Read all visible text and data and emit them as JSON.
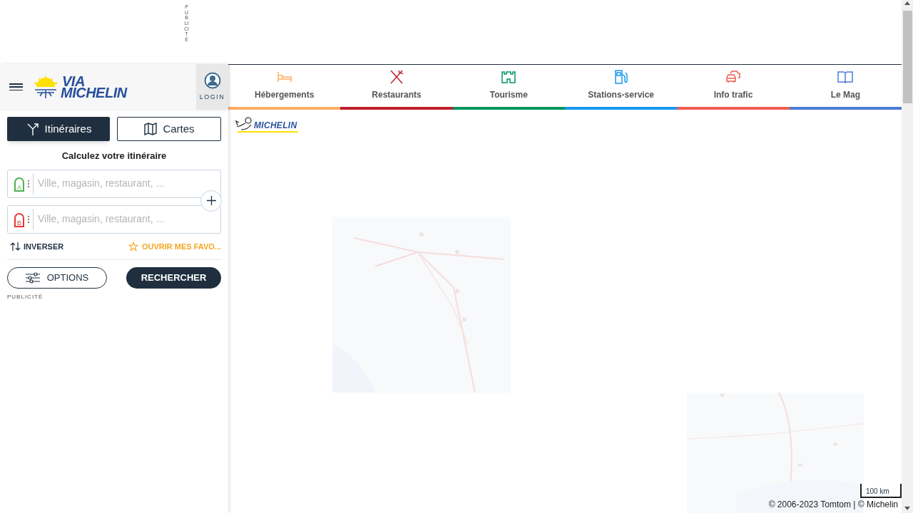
{
  "ad_banner": {
    "label": "PUBLICITÉ"
  },
  "header": {
    "logo_top": "VIA",
    "logo_bottom": "MICHELIN",
    "login": "LOGIN"
  },
  "mode_tabs": [
    {
      "label": "Itinéraires",
      "selected": true,
      "kind": "route"
    },
    {
      "label": "Cartes",
      "selected": false,
      "kind": "map"
    }
  ],
  "route_form": {
    "title": "Calculez votre itinéraire",
    "stops": [
      {
        "letter": "A",
        "color": "#4caf50",
        "placeholder": "Ville, magasin, restaurant, ..."
      },
      {
        "letter": "B",
        "color": "#e53935",
        "placeholder": "Ville, magasin, restaurant, ..."
      }
    ],
    "swap": "INVERSER",
    "favorites": "OUVRIR MES FAVO...",
    "options": "OPTIONS",
    "search": "RECHERCHER",
    "ad_label": "PUBLICITÉ"
  },
  "categories": [
    {
      "label": "Hébergements",
      "color": "#ffad66",
      "kind": "bed"
    },
    {
      "label": "Restaurants",
      "color": "#c0202e",
      "kind": "cutlery"
    },
    {
      "label": "Tourisme",
      "color": "#00955f",
      "kind": "castle"
    },
    {
      "label": "Stations-service",
      "color": "#1798ee",
      "kind": "fuel"
    },
    {
      "label": "Info trafic",
      "color": "#ef5e50",
      "kind": "cars"
    },
    {
      "label": "Le Mag",
      "color": "#4b7bd6",
      "kind": "book"
    }
  ],
  "map": {
    "brand": "MICHELIN",
    "scale": "100 km",
    "copyright": "© 2006-2023 Tomtom | © Michelin"
  }
}
